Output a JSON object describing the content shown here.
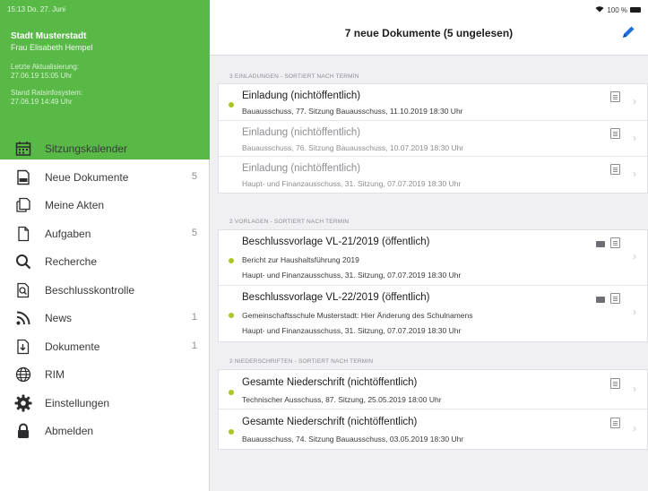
{
  "sidebar": {
    "status_time": "15:13  Do. 27. Juni",
    "org_name": "Stadt Musterstadt",
    "user_name": "Frau Elisabeth Hempel",
    "last_update_label": "Letzte Aktualisierung:",
    "last_update_value": "27.06.19 15:05 Uhr",
    "ris_label": "Stand Ratsinfosystem:",
    "ris_value": "27.06.19 14:49 Uhr",
    "items": [
      {
        "label": "Sitzungskalender",
        "badge": "",
        "icon": "calendar-icon"
      },
      {
        "label": "Neue Dokumente",
        "badge": "5",
        "icon": "new-documents-icon"
      },
      {
        "label": "Meine Akten",
        "badge": "",
        "icon": "files-icon"
      },
      {
        "label": "Aufgaben",
        "badge": "5",
        "icon": "tasks-icon"
      },
      {
        "label": "Recherche",
        "badge": "",
        "icon": "search-icon"
      },
      {
        "label": "Beschlusskontrolle",
        "badge": "",
        "icon": "resolution-control-icon"
      },
      {
        "label": "News",
        "badge": "1",
        "icon": "rss-icon"
      },
      {
        "label": "Dokumente",
        "badge": "1",
        "icon": "documents-icon"
      },
      {
        "label": "RIM",
        "badge": "",
        "icon": "globe-icon"
      },
      {
        "label": "Einstellungen",
        "badge": "",
        "icon": "gear-icon"
      },
      {
        "label": "Abmelden",
        "badge": "",
        "icon": "lock-icon"
      }
    ]
  },
  "header": {
    "title": "7 neue Dokumente (5 ungelesen)",
    "status_right": "100 %",
    "accent": "#1e6fd9"
  },
  "sections": [
    {
      "header": "3 EINLADUNGEN - SORTIERT NACH TERMIN",
      "rows": [
        {
          "title": "Einladung (nichtöffentlich)",
          "lines": [
            "Bauausschuss, 77. Sitzung Bauausschuss, 11.10.2019 18:30 Uhr"
          ],
          "unread": true
        },
        {
          "title": "Einladung (nichtöffentlich)",
          "lines": [
            "Bauausschuss, 76. Sitzung Bauausschuss, 10.07.2019 18:30 Uhr"
          ],
          "unread": false
        },
        {
          "title": "Einladung (nichtöffentlich)",
          "lines": [
            "Haupt- und Finanzausschuss, 31. Sitzung, 07.07.2019 18:30 Uhr"
          ],
          "unread": false
        }
      ]
    },
    {
      "header": "2 VORLAGEN - SORTIERT NACH TERMIN",
      "rows": [
        {
          "title": "Beschlussvorlage VL-21/2019 (öffentlich)",
          "lines": [
            "Bericht zur Haushaltsführung 2019",
            "Haupt- und Finanzausschuss, 31. Sitzung, 07.07.2019 18:30 Uhr"
          ],
          "unread": true
        },
        {
          "title": "Beschlussvorlage VL-22/2019 (öffentlich)",
          "lines": [
            "Gemeinschaftsschule Musterstadt: Hier Änderung des Schulnamens",
            "Haupt- und Finanzausschuss, 31. Sitzung, 07.07.2019 18:30 Uhr"
          ],
          "unread": true
        }
      ]
    },
    {
      "header": "2 NIEDERSCHRIFTEN - SORTIERT NACH TERMIN",
      "rows": [
        {
          "title": "Gesamte Niederschrift (nichtöffentlich)",
          "lines": [
            "Technischer Ausschuss, 87. Sitzung, 25.05.2019 18:00 Uhr"
          ],
          "unread": true
        },
        {
          "title": "Gesamte Niederschrift (nichtöffentlich)",
          "lines": [
            "Bauausschuss, 74. Sitzung Bauausschuss, 03.05.2019 18:30 Uhr"
          ],
          "unread": true
        }
      ]
    }
  ]
}
